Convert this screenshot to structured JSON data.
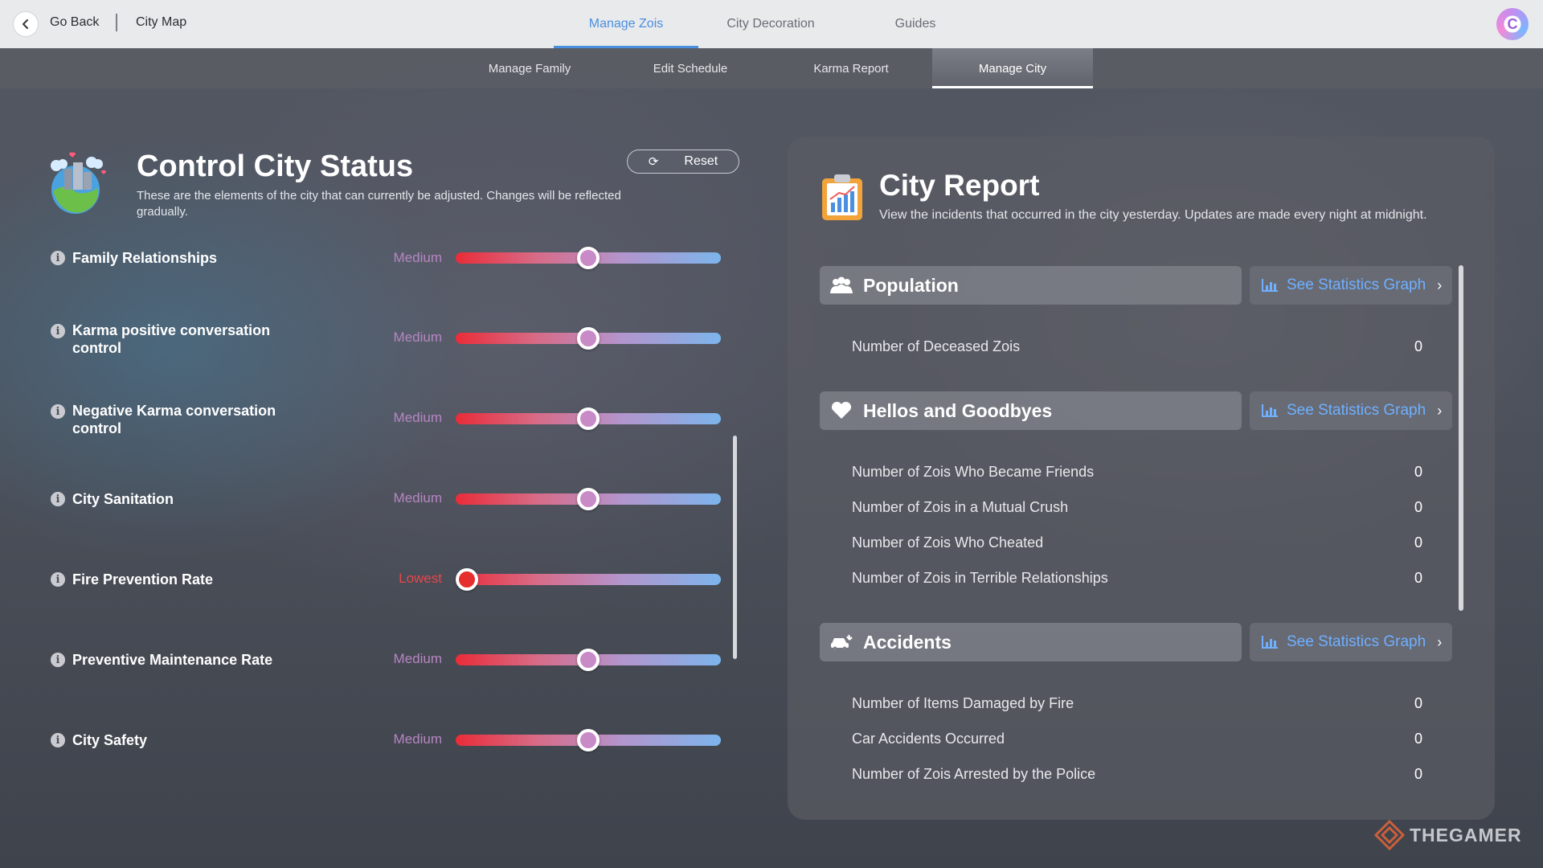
{
  "topbar": {
    "back_label": "Go Back",
    "breadcrumb": "City Map",
    "tabs": [
      {
        "label": "Manage Zois",
        "active": true
      },
      {
        "label": "City Decoration",
        "active": false
      },
      {
        "label": "Guides",
        "active": false
      }
    ],
    "avatar_letter": "C"
  },
  "subtabs": [
    {
      "label": "Manage Family",
      "active": false
    },
    {
      "label": "Edit Schedule",
      "active": false
    },
    {
      "label": "Karma Report",
      "active": false
    },
    {
      "label": "Manage City",
      "active": true
    }
  ],
  "control": {
    "title": "Control City Status",
    "description": "These are the elements of the city that can currently be adjusted. Changes will be reflected gradually.",
    "reset_label": "Reset",
    "sliders": [
      {
        "label": "Family Relationships",
        "level": "Medium",
        "value": 0.5
      },
      {
        "label": "Karma positive conversation control",
        "level": "Medium",
        "value": 0.5
      },
      {
        "label": "Negative Karma conversation control",
        "level": "Medium",
        "value": 0.5
      },
      {
        "label": "City Sanitation",
        "level": "Medium",
        "value": 0.5
      },
      {
        "label": "Fire Prevention Rate",
        "level": "Lowest",
        "value": 0.0
      },
      {
        "label": "Preventive Maintenance Rate",
        "level": "Medium",
        "value": 0.5
      },
      {
        "label": "City Safety",
        "level": "Medium",
        "value": 0.5
      }
    ]
  },
  "report": {
    "title": "City Report",
    "description": "View the incidents that occurred in the city yesterday. Updates are made every night at midnight.",
    "stat_button_label": "See Statistics Graph",
    "sections": [
      {
        "title": "Population",
        "icon": "people-icon",
        "rows": [
          {
            "label": "Number of Deceased Zois",
            "value": "0"
          }
        ]
      },
      {
        "title": "Hellos and Goodbyes",
        "icon": "heart-icon",
        "rows": [
          {
            "label": "Number of Zois Who Became Friends",
            "value": "0"
          },
          {
            "label": "Number of Zois in a Mutual Crush",
            "value": "0"
          },
          {
            "label": "Number of Zois Who Cheated",
            "value": "0"
          },
          {
            "label": "Number of Zois in Terrible Relationships",
            "value": "0"
          }
        ]
      },
      {
        "title": "Accidents",
        "icon": "car-crash-icon",
        "rows": [
          {
            "label": "Number of Items Damaged by Fire",
            "value": "0"
          },
          {
            "label": "Car Accidents Occurred",
            "value": "0"
          },
          {
            "label": "Number of Zois Arrested by the Police",
            "value": "0"
          }
        ]
      }
    ]
  },
  "watermark": "THEGAMER",
  "colors": {
    "accent": "#4a8fe0",
    "stat_link": "#6fb0ff",
    "level_medium": "#b786c2",
    "level_lowest": "#e8464a"
  }
}
